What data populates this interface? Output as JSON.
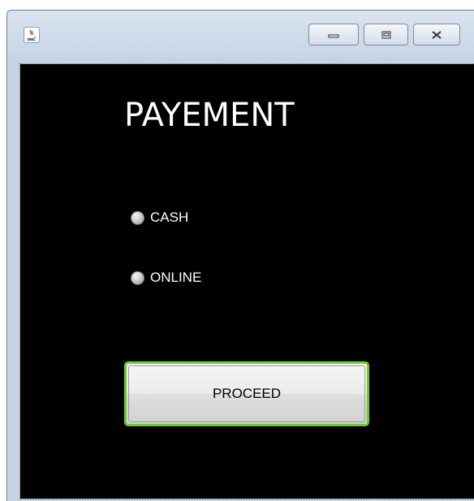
{
  "window": {
    "title_icon": "java-cup-icon",
    "controls": {
      "minimize_icon": "minimize-icon",
      "maximize_icon": "maximize-icon",
      "close_icon": "close-icon"
    }
  },
  "form": {
    "heading": "PAYEMENT",
    "options": [
      {
        "label": "CASH",
        "selected": false
      },
      {
        "label": "ONLINE",
        "selected": false
      }
    ],
    "proceed_label": "PROCEED"
  },
  "colors": {
    "background": "#000000",
    "text": "#ffffff",
    "button_focus_border": "#6ccc2a"
  }
}
